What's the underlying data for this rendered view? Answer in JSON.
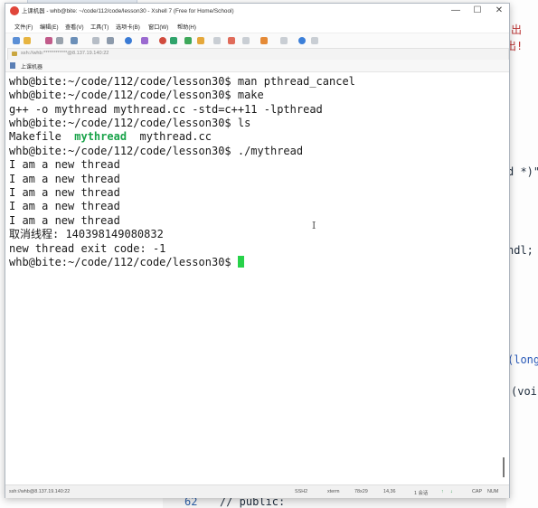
{
  "background_editor": {
    "snippets": [
      "出",
      "出!",
      "d *)\"",
      "ndl;",
      "(long",
      "(voi"
    ],
    "line_number": "62",
    "code_line": "// public:"
  },
  "window": {
    "title": "上课机器 - whb@bite: ~/code/112/code/lesson30 - Xshell 7 (Free for Home/School)",
    "minimize": "—",
    "maximize": "☐",
    "close": "✕"
  },
  "menu": [
    "文件(F)",
    "编辑(E)",
    "查看(V)",
    "工具(T)",
    "选项卡(B)",
    "窗口(W)",
    "帮助(H)"
  ],
  "address": "ssh://whb:************@8.137.19.140:22",
  "tab": "上课机器",
  "terminal": {
    "lines": [
      "whb@bite:~/code/112/code/lesson30$ man pthread_cancel",
      "whb@bite:~/code/112/code/lesson30$ make",
      "g++ -o mythread mythread.cc -std=c++11 -lpthread",
      "whb@bite:~/code/112/code/lesson30$ ls"
    ],
    "ls_output": {
      "file1": "Makefile",
      "file2": "mythread",
      "file3": "mythread.cc"
    },
    "lines2": [
      "whb@bite:~/code/112/code/lesson30$ ./mythread",
      "I am a new thread",
      "I am a new thread",
      "I am a new thread",
      "I am a new thread",
      "I am a new thread",
      "取消线程: 140398149080832",
      "new thread exit code: -1"
    ],
    "prompt": "whb@bite:~/code/112/code/lesson30$ "
  },
  "status": {
    "connection": "ssh://whb@8.137.19.140:22",
    "protocol": "SSH2",
    "term": "xterm",
    "size": "78x29",
    "position": "14,36",
    "sessions": "1 会话",
    "cap": "CAP",
    "num": "NUM"
  },
  "colors": {
    "executable": "#1aa34a",
    "cursor": "#27d24a"
  }
}
